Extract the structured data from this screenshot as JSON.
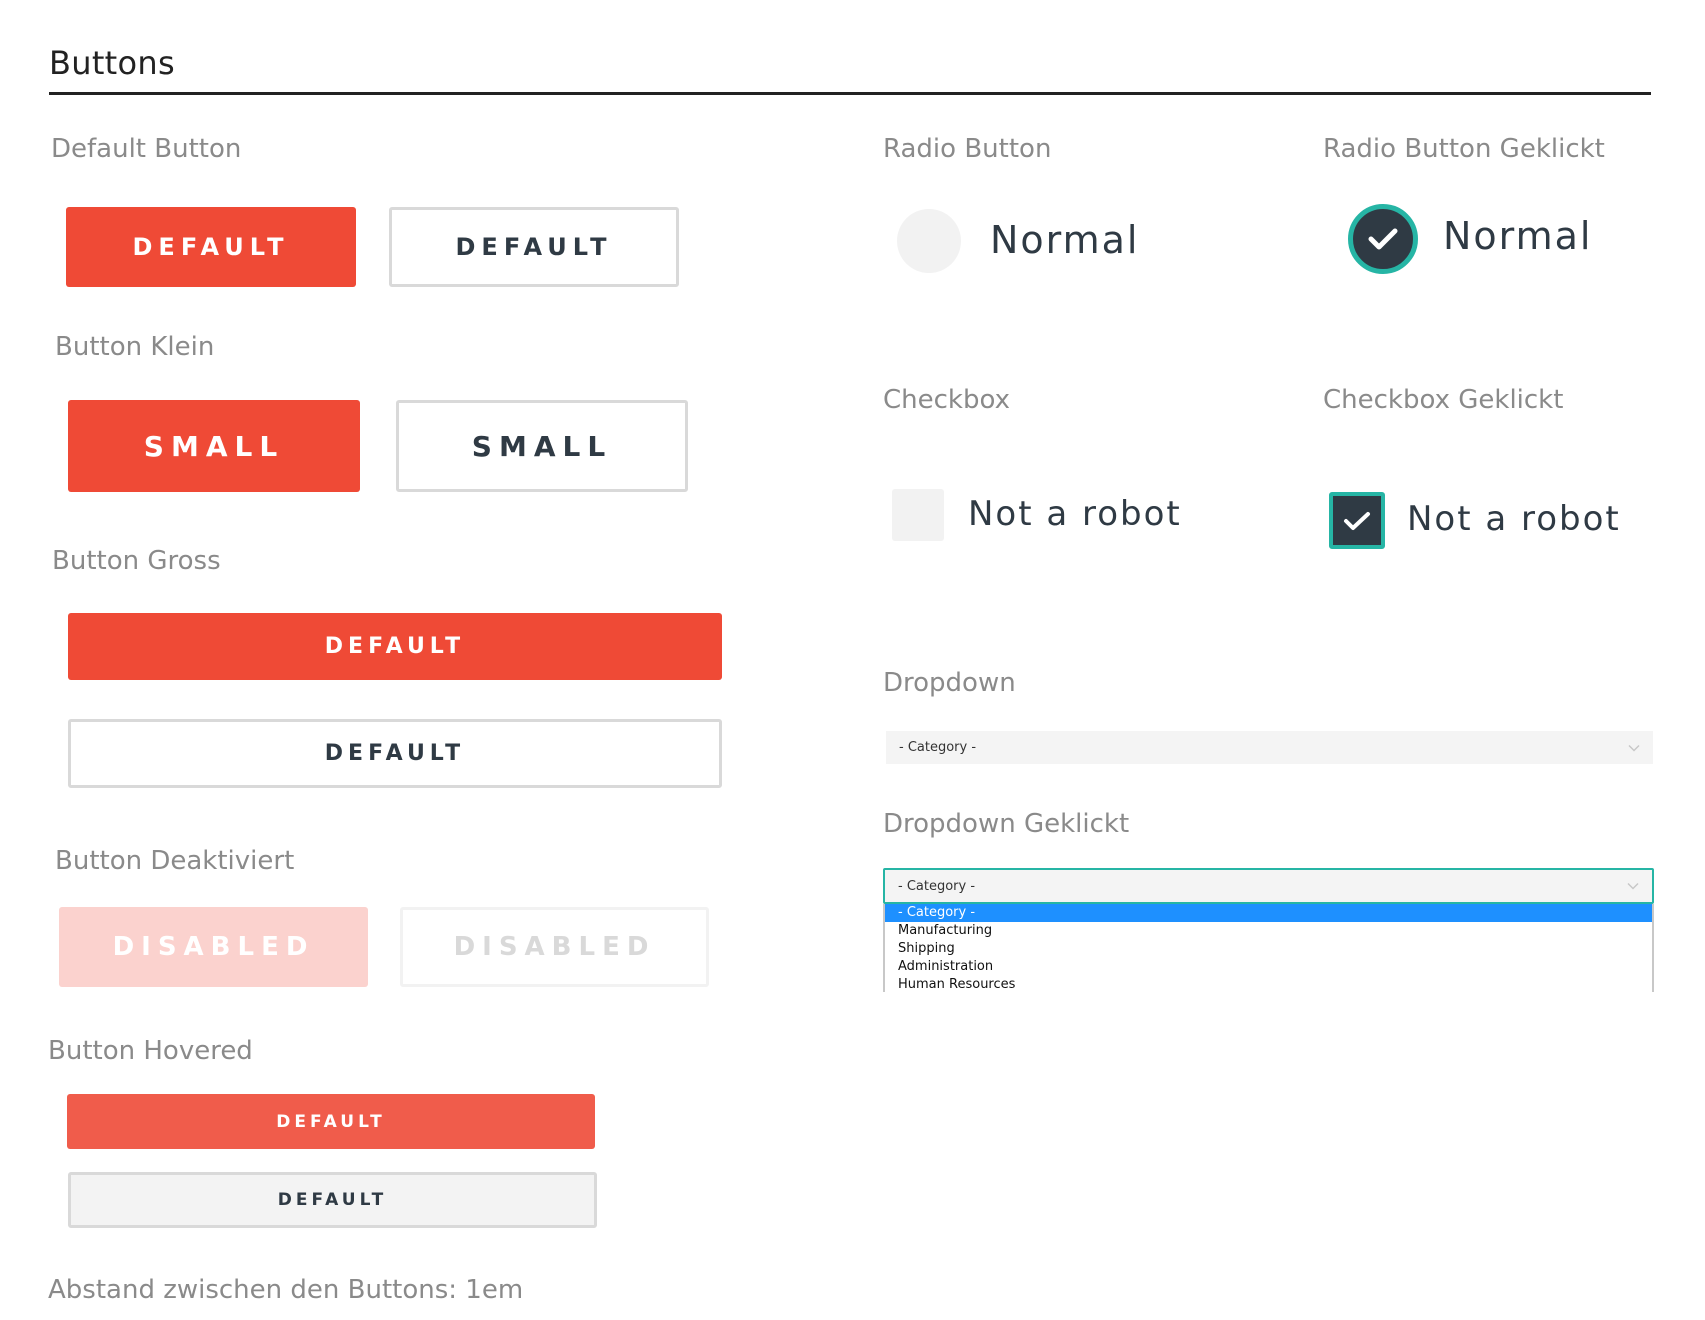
{
  "page": {
    "title": "Buttons",
    "footer_note": "Abstand zwischen den Buttons: 1em"
  },
  "colors": {
    "primary": "#ef4a36",
    "primary_hover": "#f05c4b",
    "primary_disabled": "#fbd2ce",
    "dark": "#2f3a44",
    "accent_teal": "#26b5a5",
    "muted_label": "#8a8a8a",
    "outline_border": "#d9d9d9",
    "select_highlight": "#1e90ff"
  },
  "sections": {
    "default_button": {
      "label": "Default Button",
      "primary_label": "DEFAULT",
      "outline_label": "DEFAULT"
    },
    "small_button": {
      "label": "Button Klein",
      "primary_label": "SMALL",
      "outline_label": "SMALL"
    },
    "large_button": {
      "label": "Button Gross",
      "primary_label": "DEFAULT",
      "outline_label": "DEFAULT"
    },
    "disabled_button": {
      "label": "Button Deaktiviert",
      "primary_label": "DISABLED",
      "outline_label": "DISABLED"
    },
    "hovered_button": {
      "label": "Button Hovered",
      "primary_label": "DEFAULT",
      "outline_label": "DEFAULT"
    },
    "radio": {
      "label": "Radio Button",
      "option_label": "Normal",
      "checked": false
    },
    "radio_checked": {
      "label": "Radio Button Geklickt",
      "option_label": "Normal",
      "checked": true
    },
    "checkbox": {
      "label": "Checkbox",
      "option_label": "Not a robot",
      "checked": false
    },
    "checkbox_checked": {
      "label": "Checkbox Geklickt",
      "option_label": "Not a robot",
      "checked": true
    },
    "dropdown": {
      "label": "Dropdown",
      "value": "- Category -"
    },
    "dropdown_open": {
      "label": "Dropdown Geklickt",
      "value": "- Category -",
      "options": [
        "- Category -",
        "Manufacturing",
        "Shipping",
        "Administration",
        "Human Resources"
      ],
      "selected_index": 0
    }
  },
  "icons": {
    "check": "check-icon",
    "chevron": "chevron-down-icon"
  }
}
